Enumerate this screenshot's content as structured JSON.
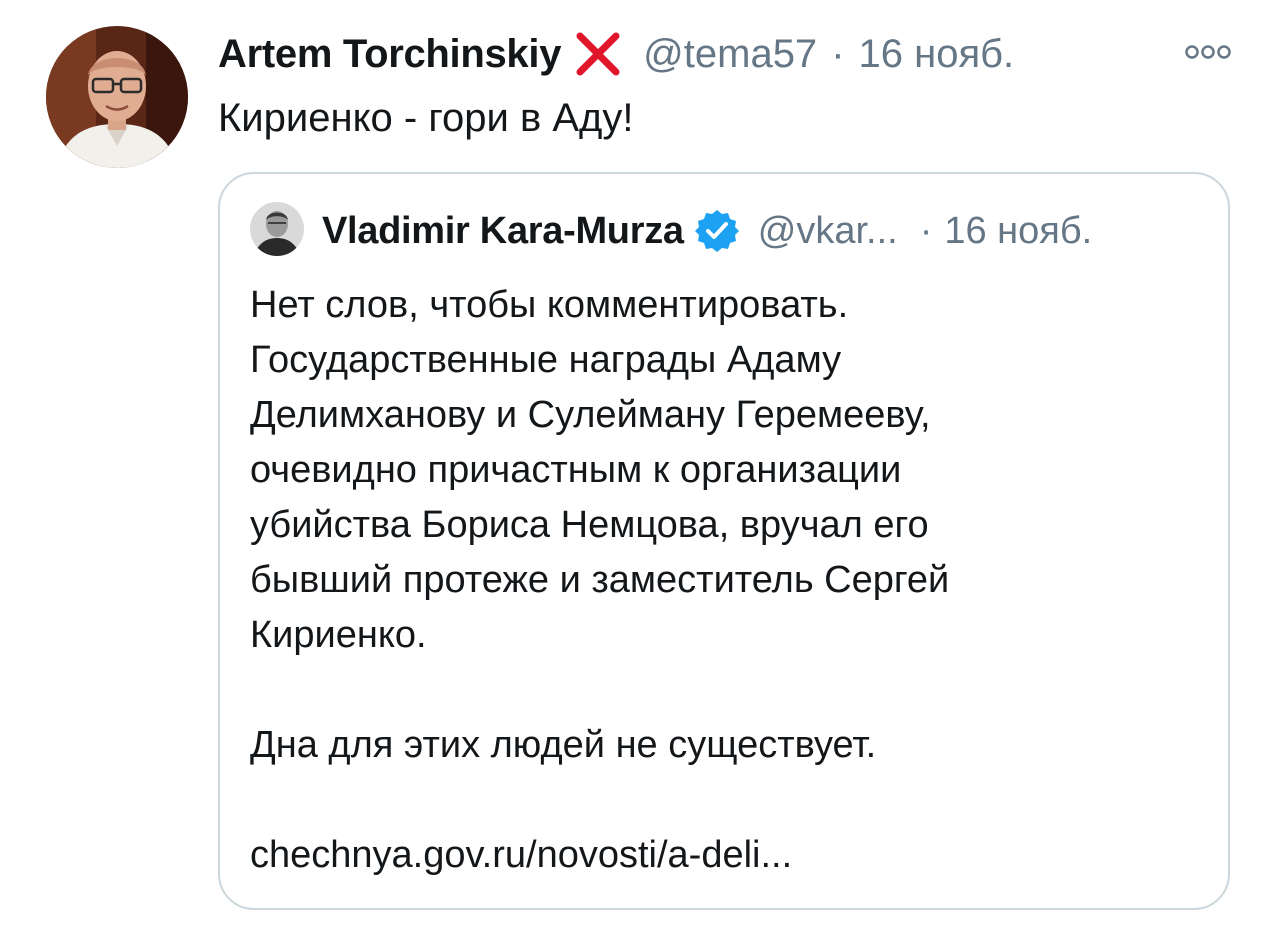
{
  "tweet": {
    "author_name": "Artem Torchinskiy",
    "author_badge_icon": "red-x-icon",
    "handle": "@tema57",
    "separator": "·",
    "date": "16 нояб.",
    "more_icon": "more-options-icon",
    "text": "Кириенко - гори в Аду!"
  },
  "quoted_tweet": {
    "author_name": "Vladimir Kara-Murza",
    "verified_icon": "verified-badge-icon",
    "handle": "@vkar...",
    "separator": "·",
    "date": "16 нояб.",
    "lines": [
      "Нет слов, чтобы комментировать.",
      "Государственные награды Адаму",
      "Делимханову и Сулейману Геремееву,",
      "очевидно причастным к организации",
      "убийства Бориса Немцова, вручал его",
      "бывший протеже и заместитель Сергей",
      "Кириенко."
    ],
    "closing_line": "Дна для этих людей не существует.",
    "link": "chechnya.gov.ru/novosti/a-deli..."
  },
  "colors": {
    "text": "#14171a",
    "secondary": "#657786",
    "border": "#ccd6dd",
    "verified": "#1da1f2",
    "x_badge": "#e0162b"
  }
}
